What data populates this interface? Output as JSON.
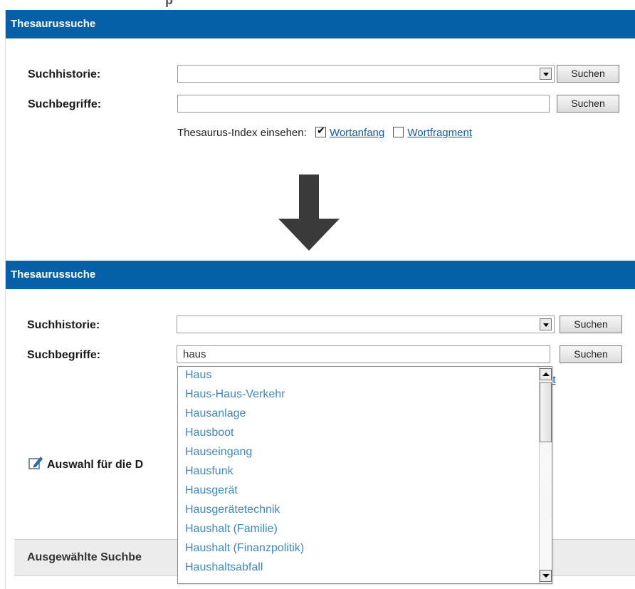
{
  "panel1": {
    "header": "Thesaurussuche",
    "suchhistorie_label": "Suchhistorie:",
    "suchhistorie_button": "Suchen",
    "suchbegriffe_label": "Suchbegriffe:",
    "suchbegriffe_value": "",
    "suchbegriffe_button": "Suchen",
    "index_label": "Thesaurus-Index einsehen:",
    "option_wortanfang": {
      "label": "Wortanfang",
      "checked": true
    },
    "option_wortfragment": {
      "label": "Wortfragment",
      "checked": false
    }
  },
  "transition_arrow": {
    "icon": "down-arrow-icon",
    "color": "#333333"
  },
  "panel2": {
    "header": "Thesaurussuche",
    "suchhistorie_label": "Suchhistorie:",
    "suchhistorie_button": "Suchen",
    "suchbegriffe_label": "Suchbegriffe:",
    "suchbegriffe_value": "haus",
    "suchbegriffe_button": "Suchen",
    "partial_link": "nt",
    "auswahl_label": "Auswahl für die D",
    "selected_terms_label": "Ausgewählte Suchbe"
  },
  "autocomplete": {
    "items": [
      "Haus",
      "Haus-Haus-Verkehr",
      "Hausanlage",
      "Hausboot",
      "Hauseingang",
      "Hausfunk",
      "Hausgerät",
      "Hausgerätetechnik",
      "Haushalt (Familie)",
      "Haushalt (Finanzpolitik)",
      "Haushaltsabfall"
    ]
  },
  "colors": {
    "header_bg": "#0560a8",
    "link": "#165ca3",
    "suggestion_text": "#3f88bf"
  }
}
